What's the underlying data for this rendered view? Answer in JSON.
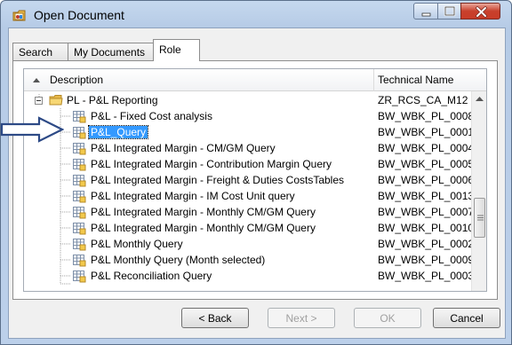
{
  "window": {
    "title": "Open Document"
  },
  "tabs": [
    {
      "label": "Search"
    },
    {
      "label": "My Documents"
    },
    {
      "label": "Role"
    }
  ],
  "columns": {
    "description": "Description",
    "technical_name": "Technical Name"
  },
  "folder": {
    "label": "PL - P&L Reporting",
    "technical_name": "ZR_RCS_CA_M12"
  },
  "rows": [
    {
      "label": "P&L - Fixed Cost analysis",
      "technical_name": "BW_WBK_PL_0008"
    },
    {
      "label": "P&L_Query",
      "technical_name": "BW_WBK_PL_0001",
      "selected": true
    },
    {
      "label": "P&L Integrated Margin - CM/GM Query",
      "technical_name": "BW_WBK_PL_0004"
    },
    {
      "label": "P&L Integrated Margin - Contribution Margin Query",
      "technical_name": "BW_WBK_PL_0005"
    },
    {
      "label": "P&L Integrated Margin - Freight & Duties CostsTables",
      "technical_name": "BW_WBK_PL_0006"
    },
    {
      "label": "P&L Integrated Margin - IM Cost Unit query",
      "technical_name": "BW_WBK_PL_0013"
    },
    {
      "label": "P&L Integrated Margin - Monthly CM/GM Query",
      "technical_name": "BW_WBK_PL_0007"
    },
    {
      "label": "P&L Integrated Margin - Monthly CM/GM Query",
      "technical_name": "BW_WBK_PL_0010"
    },
    {
      "label": "P&L Monthly Query",
      "technical_name": "BW_WBK_PL_0002"
    },
    {
      "label": "P&L Monthly Query (Month selected)",
      "technical_name": "BW_WBK_PL_0009"
    },
    {
      "label": "P&L Reconciliation Query",
      "technical_name": "BW_WBK_PL_0003"
    }
  ],
  "buttons": {
    "back": "< Back",
    "next": "Next >",
    "ok": "OK",
    "cancel": "Cancel"
  },
  "colors": {
    "selection": "#3399ff",
    "folder": "#f2c94c",
    "arrow_border": "#2d4a86"
  }
}
